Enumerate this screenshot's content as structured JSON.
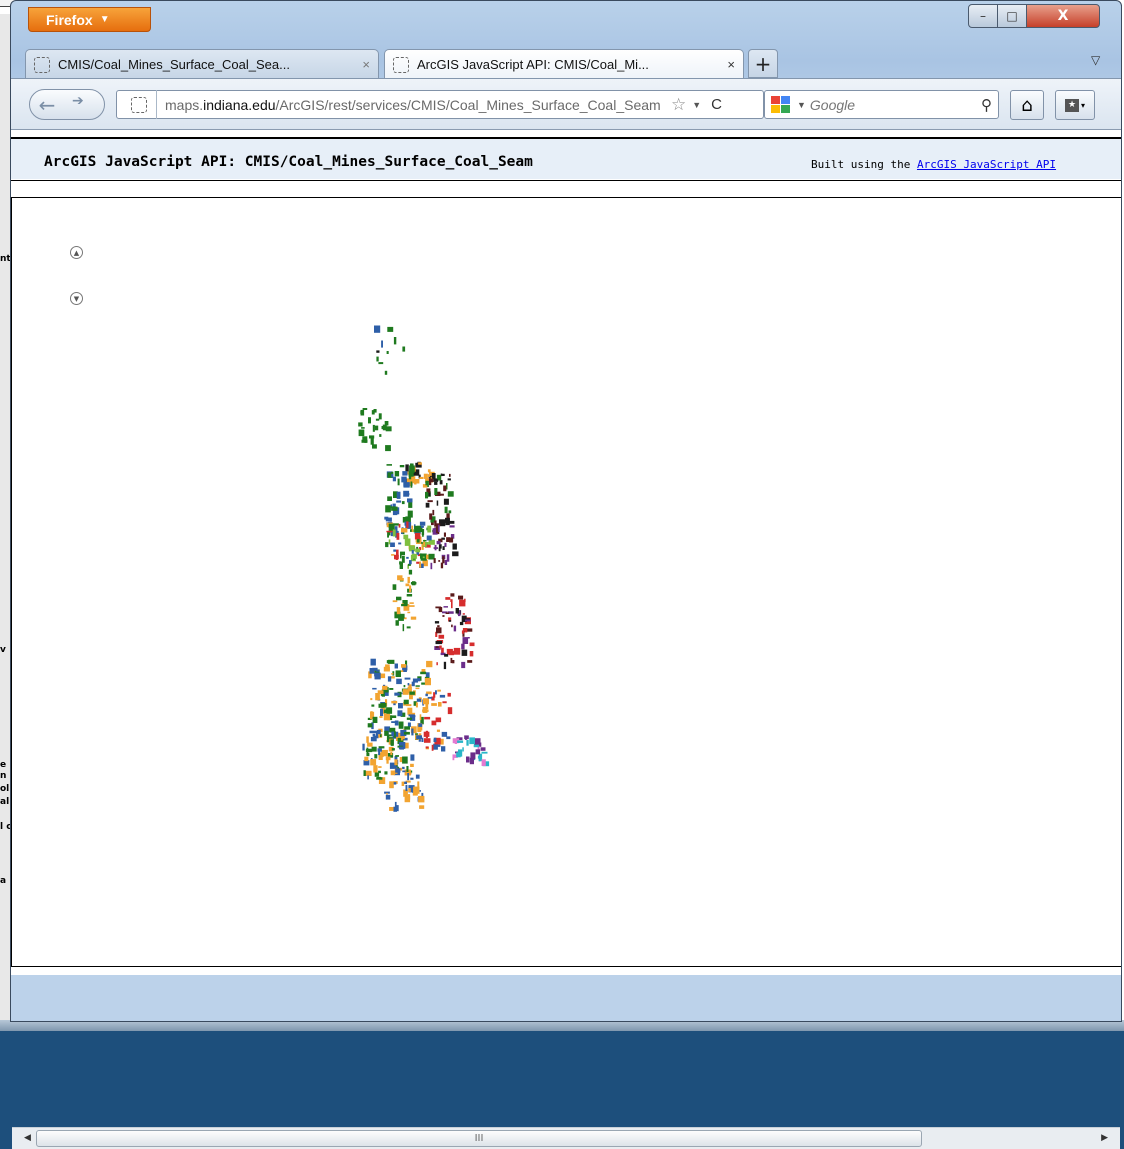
{
  "browser": {
    "menu_button": "Firefox",
    "window_controls": {
      "minimize": "–",
      "maximize": "□",
      "close": "X"
    }
  },
  "tabs": [
    {
      "title": "CMIS/Coal_Mines_Surface_Coal_Sea...",
      "active": false
    },
    {
      "title": "ArcGIS JavaScript API: CMIS/Coal_Mi...",
      "active": true
    }
  ],
  "navbar": {
    "url_prefix": "maps.",
    "url_domain": "indiana.edu",
    "url_path": "/ArcGIS/rest/services/CMIS/Coal_Mines_Surface_Coal_Seam",
    "search_placeholder": "Google"
  },
  "page": {
    "title": "ArcGIS JavaScript API: CMIS/Coal_Mines_Surface_Coal_Seam",
    "built_prefix": "Built using the ",
    "built_link": "ArcGIS JavaScript API"
  },
  "map": {
    "zoom_in": "▲",
    "zoom_out": "▼",
    "feature_colors": [
      "#2e5fa8",
      "#1f7a1f",
      "#f2a431",
      "#d62d2d",
      "#6b2d8a",
      "#5a1a1a",
      "#1b1b1b",
      "#7fbf3f",
      "#29b6c8",
      "#e47ad1"
    ]
  },
  "backdrop_fragments": [
    "nt",
    "v",
    "e",
    "n",
    "ol",
    "al",
    "l c",
    "a"
  ],
  "scrollbar": {
    "left": "◀",
    "right": "▶",
    "grip": "III"
  }
}
